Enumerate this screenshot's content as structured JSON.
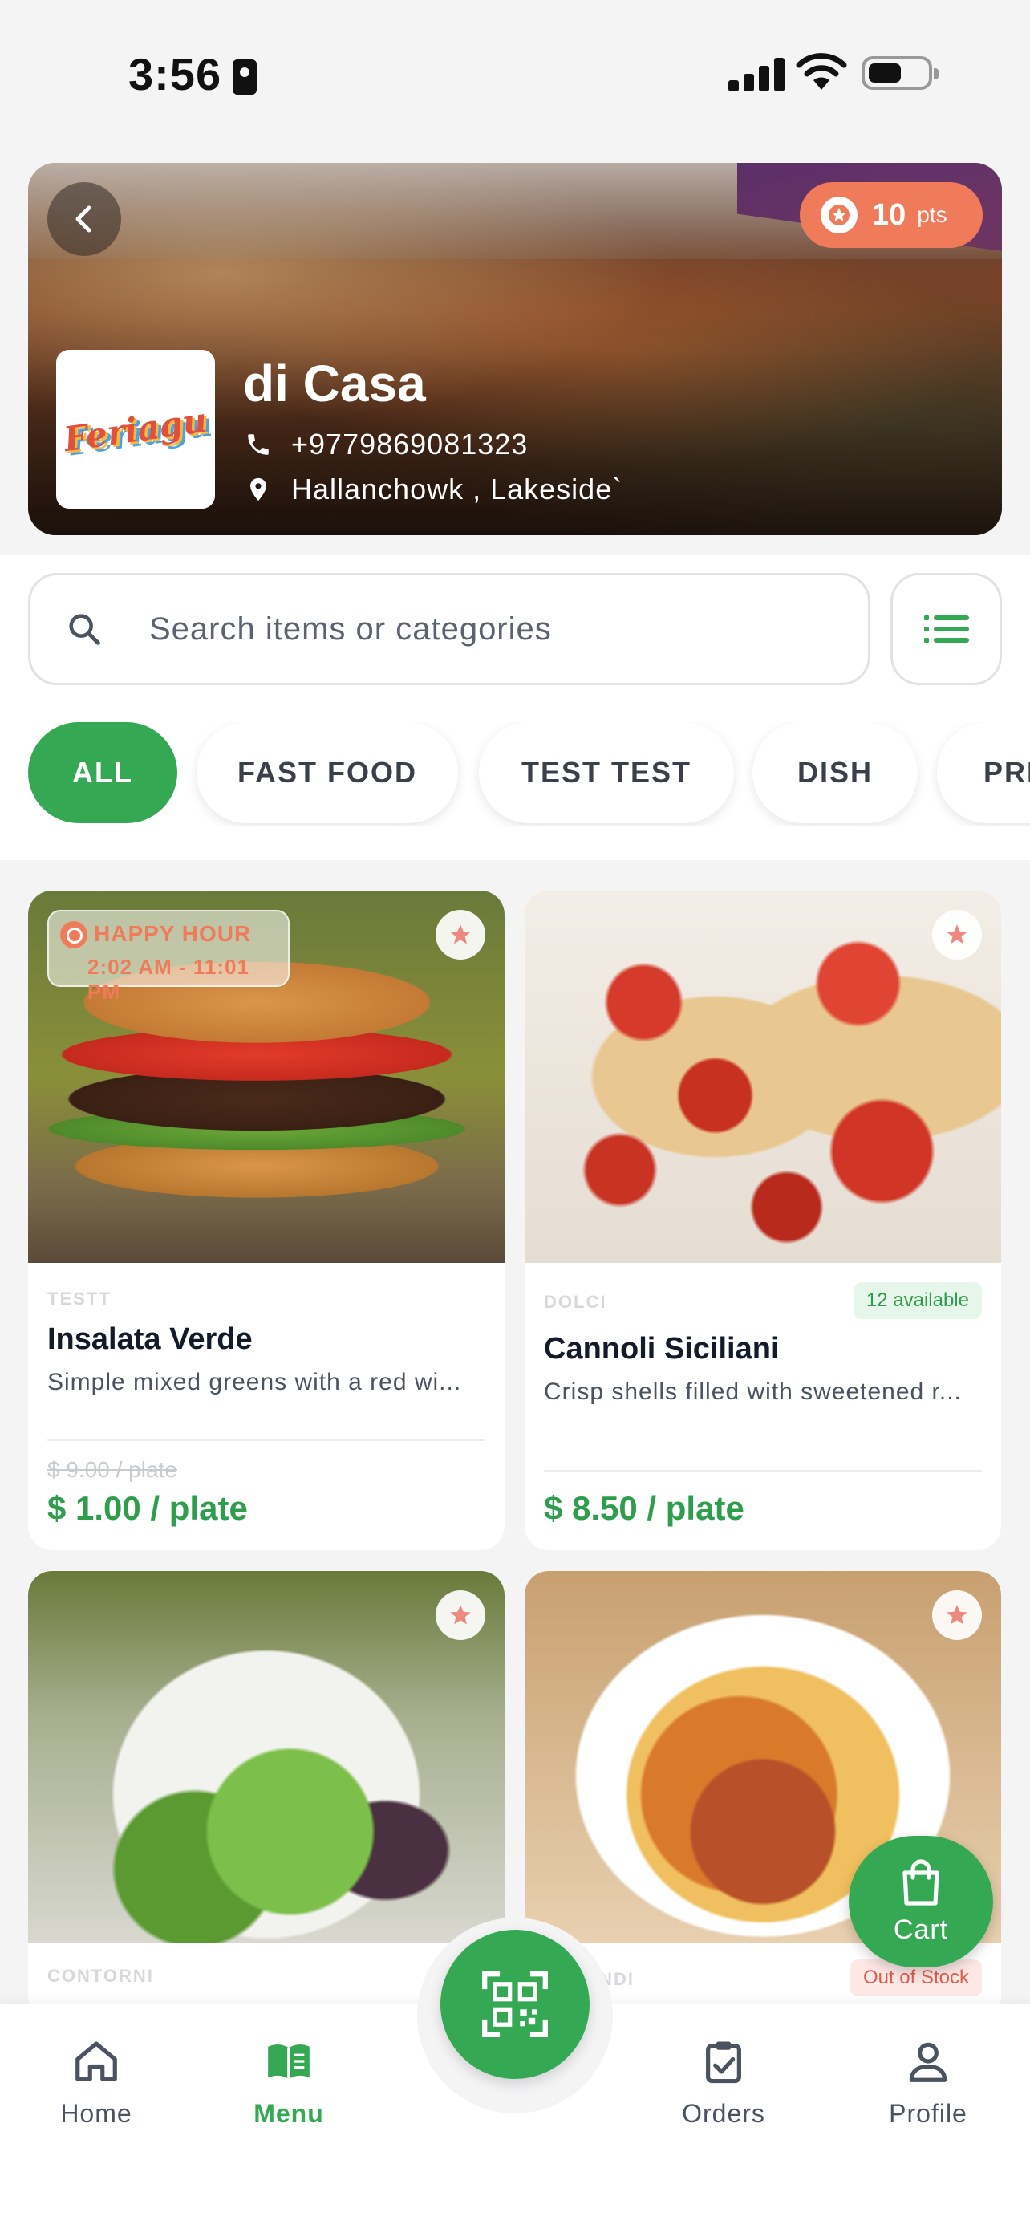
{
  "status_bar": {
    "time": "3:56"
  },
  "header": {
    "restaurant_name": "di Casa",
    "phone": "+9779869081323",
    "address": "Hallanchowk , Lakeside`",
    "logo_text": "Feriagu",
    "points_value": "10",
    "points_unit": "pts"
  },
  "search": {
    "placeholder": "Search items or categories"
  },
  "categories": [
    {
      "label": "ALL",
      "active": true
    },
    {
      "label": "FAST FOOD"
    },
    {
      "label": "TEST TEST"
    },
    {
      "label": "DISH"
    },
    {
      "label": "PRI"
    }
  ],
  "items": [
    {
      "category": "TESTT",
      "name": "Insalata Verde",
      "description": "Simple mixed greens with a red wi...",
      "old_price": "$ 9.00 / plate",
      "price": "$ 1.00 / plate",
      "happy_hour_title": "HAPPY HOUR",
      "happy_hour_time": "2:02 AM - 11:01 PM"
    },
    {
      "category": "DOLCI",
      "availability": "12 available",
      "name": "Cannoli Siciliani",
      "description": "Crisp shells filled with sweetened r...",
      "price": "$ 8.50 / plate"
    },
    {
      "category": "CONTORNI"
    },
    {
      "category": "ONDI",
      "availability": "Out of Stock"
    }
  ],
  "cart": {
    "label": "Cart"
  },
  "nav": {
    "home": "Home",
    "menu": "Menu",
    "orders": "Orders",
    "profile": "Profile"
  },
  "colors": {
    "primary": "#34a853",
    "accent": "#f07b5a"
  }
}
